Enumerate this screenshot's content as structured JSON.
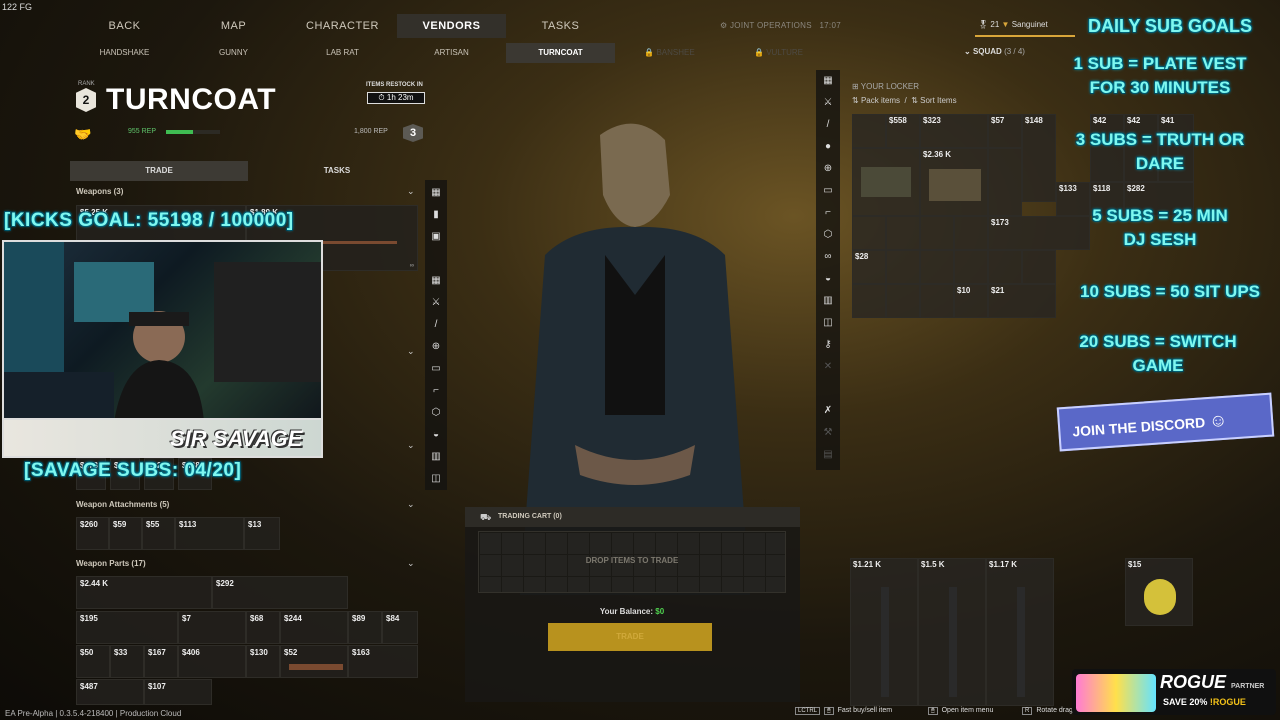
{
  "fps": "122 FG",
  "top_nav": [
    {
      "label": "BACK"
    },
    {
      "label": "MAP"
    },
    {
      "label": "CHARACTER"
    },
    {
      "label": "VENDORS",
      "active": true
    },
    {
      "label": "TASKS"
    }
  ],
  "joint_ops": {
    "label": "JOINT OPERATIONS",
    "time": "17:07"
  },
  "vendors": [
    {
      "label": "HANDSHAKE"
    },
    {
      "label": "GUNNY"
    },
    {
      "label": "LAB RAT"
    },
    {
      "label": "ARTISAN"
    },
    {
      "label": "TURNCOAT",
      "active": true
    },
    {
      "label": "BANSHEE",
      "locked": true
    },
    {
      "label": "VULTURE",
      "locked": true
    }
  ],
  "vendor": {
    "rank_label": "RANK",
    "rank": "2",
    "name": "TURNCOAT",
    "restock_label": "ITEMS RESTOCK IN",
    "restock_time": "1h 23m",
    "rep_current": "955 REP",
    "rep_fraction": 0.5,
    "rep_next": "1,800 REP",
    "next_rank": "3"
  },
  "tabs": {
    "trade": "TRADE",
    "tasks": "TASKS"
  },
  "sections": {
    "weapons": "Weapons (3)",
    "attachments": "Weapon Attachments (5)",
    "parts": "Weapon Parts (17)"
  },
  "weapons": [
    "$5.25 K",
    "$1.89 K"
  ],
  "partial_row": [
    "$678",
    "$41",
    "$22",
    "$468"
  ],
  "attachments": [
    "$260",
    "$59",
    "$55",
    "$113",
    "$13"
  ],
  "parts_row1": [
    "$2.44 K",
    "$292"
  ],
  "parts_row2": [
    "$195",
    "$7",
    "$68",
    "$244",
    "$89",
    "$84"
  ],
  "parts_row3": [
    "$50",
    "$33",
    "$167",
    "$406",
    "$130",
    "$52",
    "$163"
  ],
  "parts_row4": [
    "$487",
    "$107"
  ],
  "cart": {
    "title": "TRADING CART (0)",
    "drop": "DROP ITEMS TO TRADE",
    "balance_label": "Your Balance:",
    "balance": "$0",
    "button": "TRADE"
  },
  "player": {
    "level": "21",
    "name": "Sanguinet",
    "squad": "SQUAD",
    "squad_count": "(3 / 4)"
  },
  "locker": {
    "title": "YOUR LOCKER",
    "pack": "Pack items",
    "sort": "Sort Items"
  },
  "locker_prices": [
    "$558",
    "$323",
    "$57",
    "$148",
    "$42",
    "$42",
    "$41",
    "$2.36 K",
    "$133",
    "$118",
    "$282",
    "$173",
    "$28",
    "$10",
    "$21"
  ],
  "gear_prices": [
    "$1.21 K",
    "$1.5 K",
    "$1.17 K",
    "$15"
  ],
  "bottom": {
    "version": "EA Pre-Alpha | 0.3.5.4-218400 | Production Cloud",
    "hint1_key": "LCTRL",
    "hint1": "Fast buy/sell item",
    "hint2": "Open item menu",
    "hint3": "Rotate dragged"
  },
  "overlay": {
    "kicks": "[KICKS GOAL: 55198 / 100000]",
    "subs": "[SAVAGE SUBS: 04/20]",
    "streamer": "SIR SAVAGE",
    "goals_title": "DAILY SUB GOALS",
    "goals": [
      "1 SUB = PLATE VEST FOR 30 MINUTES",
      "3 SUBS = TRUTH OR DARE",
      "5 SUBS = 25 MIN DJ SESH",
      "10 SUBS = 50 SIT UPS",
      "20 SUBS = SWITCH GAME"
    ],
    "discord": "JOIN THE DISCORD",
    "rogue": "ROGUE",
    "rogue_partner": "PARTNER",
    "rogue_code_prefix": "SAVE 20%",
    "rogue_code": "!ROGUE"
  }
}
